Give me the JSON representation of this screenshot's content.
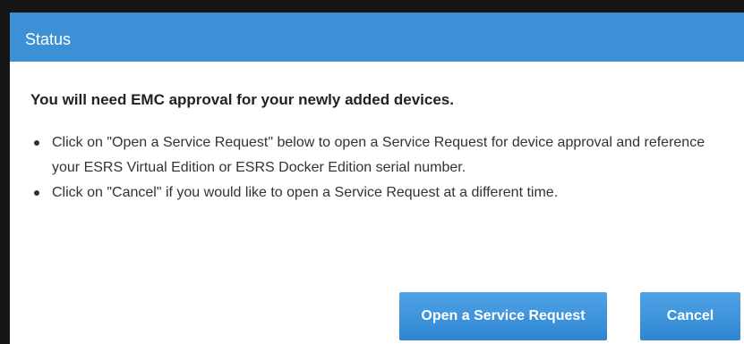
{
  "dialog": {
    "title": "Status",
    "heading": "You will need EMC approval for your newly added devices.",
    "bullets": [
      "Click on \"Open a Service Request\" below to open a Service Request for device approval and reference your ESRS Virtual Edition or ESRS Docker Edition serial number.",
      "Click on \"Cancel\" if you would like to open a Service Request at a different time."
    ],
    "buttons": {
      "open_label": "Open a Service Request",
      "cancel_label": "Cancel"
    }
  },
  "colors": {
    "title_bar": "#3d8fd6",
    "button": "#3a8fd8",
    "frame": "#151515"
  }
}
